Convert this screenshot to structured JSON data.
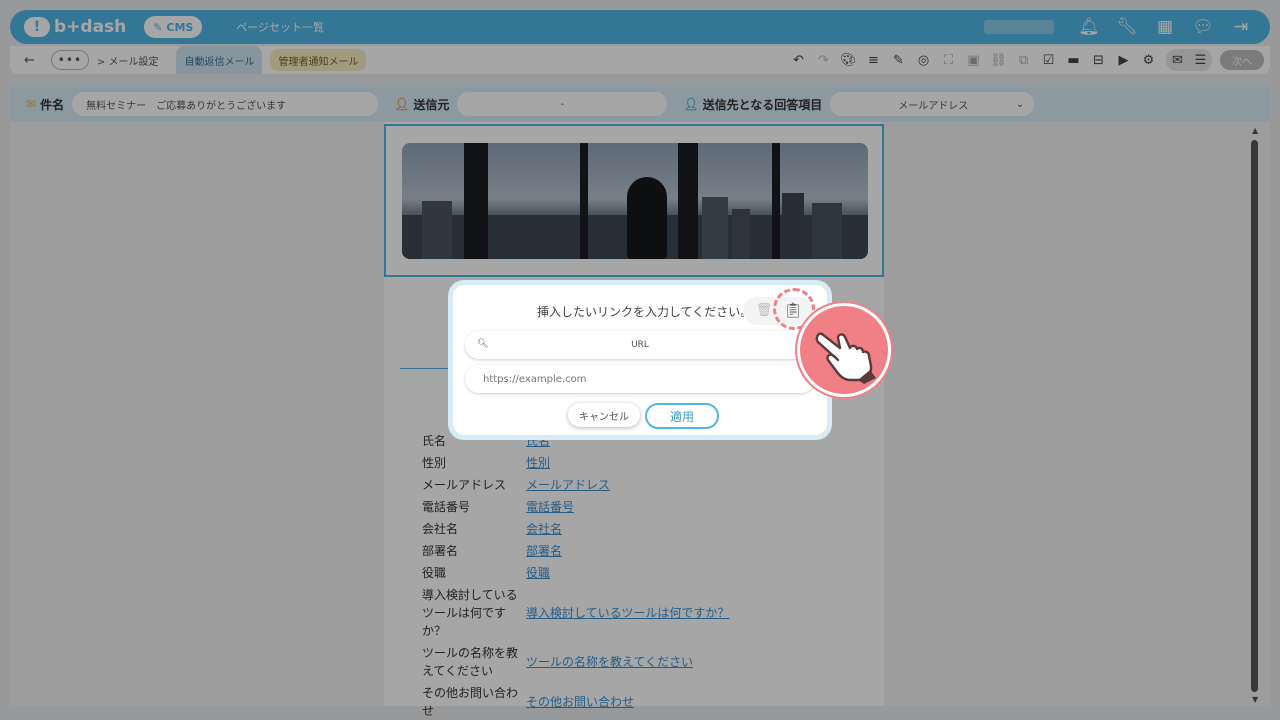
{
  "header": {
    "logo_text": "b+dash",
    "cms_label": "CMS",
    "page_link": "ページセット一覧"
  },
  "subbar": {
    "more": "•••",
    "breadcrumb": "> メール設定",
    "tab_active": "自動返信メール",
    "tab_other": "管理者通知メール",
    "next_label": "次へ"
  },
  "fields": {
    "subject_label": "件名",
    "subject_value": "無料セミナー　ご応募ありがとうございます",
    "sender_label": "送信元",
    "sender_value": "-",
    "recipient_label": "送信先となる回答項目",
    "recipient_value": "メールアドレス"
  },
  "form_rows": [
    {
      "key": "氏名",
      "value": "氏名"
    },
    {
      "key": "性別",
      "value": "性別"
    },
    {
      "key": "メールアドレス",
      "value": "メールアドレス"
    },
    {
      "key": "電話番号",
      "value": "電話番号"
    },
    {
      "key": "会社名",
      "value": "会社名"
    },
    {
      "key": "部署名",
      "value": "部署名"
    },
    {
      "key": "役職",
      "value": "役職"
    },
    {
      "key": "導入検討しているツールは何ですか？",
      "value": "導入検討しているツールは何ですか？"
    },
    {
      "key": "ツールの名称を教えてください",
      "value": "ツールの名称を教えてください"
    },
    {
      "key": "その他お問い合わせ",
      "value": "その他お問い合わせ"
    }
  ],
  "dialog": {
    "title": "挿入したいリンクを入力してください。",
    "select_value": "URL",
    "input_placeholder": "https://example.com",
    "cancel_label": "キャンセル",
    "apply_label": "適用"
  },
  "colors": {
    "accent": "#4fb6e6",
    "highlight": "#f07f86"
  }
}
